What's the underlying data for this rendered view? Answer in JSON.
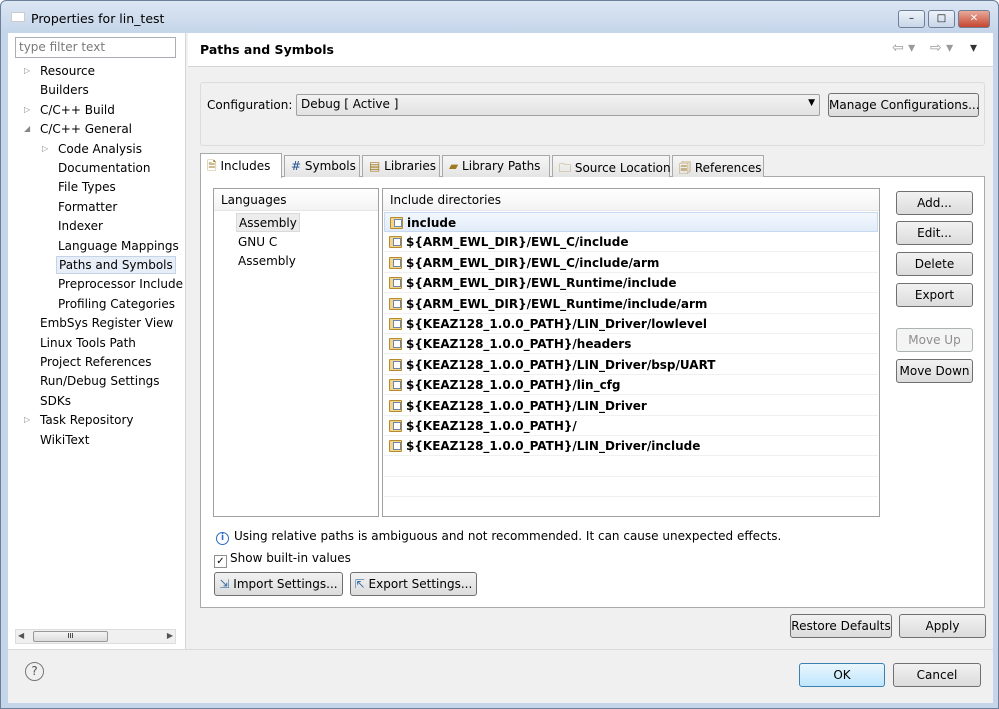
{
  "window": {
    "title": "Properties for lin_test",
    "logo": "NXP",
    "min": "–",
    "max": "□",
    "close": "✕"
  },
  "sidebar": {
    "filter_placeholder": "type filter text",
    "items": [
      {
        "label": "Resource",
        "level": 0,
        "twisty": "collapsed"
      },
      {
        "label": "Builders",
        "level": 0
      },
      {
        "label": "C/C++ Build",
        "level": 0,
        "twisty": "collapsed"
      },
      {
        "label": "C/C++ General",
        "level": 0,
        "twisty": "expanded"
      },
      {
        "label": "Code Analysis",
        "level": 1,
        "twisty": "collapsed"
      },
      {
        "label": "Documentation",
        "level": 1
      },
      {
        "label": "File Types",
        "level": 1
      },
      {
        "label": "Formatter",
        "level": 1
      },
      {
        "label": "Indexer",
        "level": 1
      },
      {
        "label": "Language Mappings",
        "level": 1
      },
      {
        "label": "Paths and Symbols",
        "level": 1,
        "selected": true
      },
      {
        "label": "Preprocessor Include",
        "level": 1
      },
      {
        "label": "Profiling Categories",
        "level": 1
      },
      {
        "label": "EmbSys Register View",
        "level": 0
      },
      {
        "label": "Linux Tools Path",
        "level": 0
      },
      {
        "label": "Project References",
        "level": 0
      },
      {
        "label": "Run/Debug Settings",
        "level": 0
      },
      {
        "label": "SDKs",
        "level": 0
      },
      {
        "label": "Task Repository",
        "level": 0,
        "twisty": "collapsed"
      },
      {
        "label": "WikiText",
        "level": 0
      }
    ]
  },
  "page": {
    "title": "Paths and Symbols",
    "config_label": "Configuration:",
    "config_value": "Debug  [ Active ]",
    "manage_button": "Manage Configurations...",
    "tabs": [
      "Includes",
      "Symbols",
      "Libraries",
      "Library Paths",
      "Source Location",
      "References"
    ],
    "tab_icons": [
      "include-icon",
      "hash-icon",
      "library-icon",
      "library-path-icon",
      "source-folder-icon",
      "references-icon"
    ],
    "active_tab": "Includes",
    "languages_header": "Languages",
    "languages": [
      "Assembly",
      "GNU C",
      "Assembly"
    ],
    "includes_header": "Include directories",
    "includes": [
      "include",
      "${ARM_EWL_DIR}/EWL_C/include",
      "${ARM_EWL_DIR}/EWL_C/include/arm",
      "${ARM_EWL_DIR}/EWL_Runtime/include",
      "${ARM_EWL_DIR}/EWL_Runtime/include/arm",
      "${KEAZ128_1.0.0_PATH}/LIN_Driver/lowlevel",
      "${KEAZ128_1.0.0_PATH}/headers",
      "${KEAZ128_1.0.0_PATH}/LIN_Driver/bsp/UART",
      "${KEAZ128_1.0.0_PATH}/lin_cfg",
      "${KEAZ128_1.0.0_PATH}/LIN_Driver",
      "${KEAZ128_1.0.0_PATH}/",
      "${KEAZ128_1.0.0_PATH}/LIN_Driver/include"
    ],
    "side_buttons": {
      "add": "Add...",
      "edit": "Edit...",
      "delete": "Delete",
      "export": "Export",
      "move_up": "Move Up",
      "move_down": "Move Down"
    },
    "info": "Using relative paths is ambiguous and not recommended. It can cause unexpected effects.",
    "show_builtin": "Show built-in values",
    "show_builtin_checked": true,
    "import_settings": "Import Settings...",
    "export_settings": "Export Settings...",
    "restore_defaults": "Restore Defaults",
    "apply": "Apply"
  },
  "footer": {
    "help": "?",
    "ok": "OK",
    "cancel": "Cancel"
  }
}
